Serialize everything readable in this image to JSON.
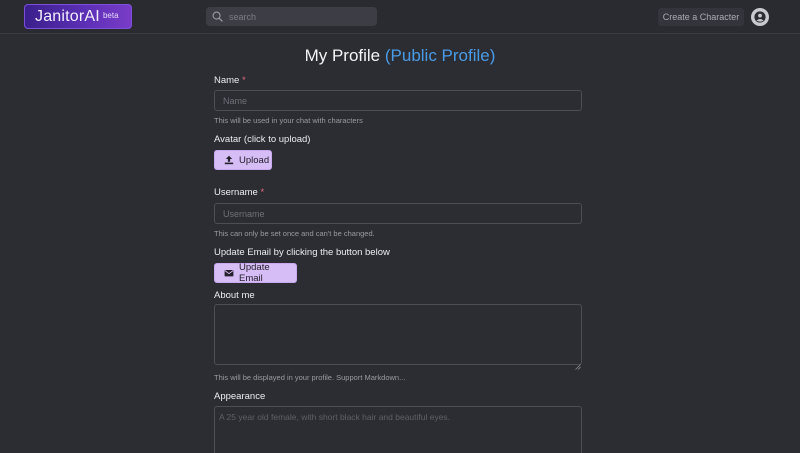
{
  "header": {
    "logo_text": "JanitorAI",
    "logo_badge": "beta",
    "search_placeholder": "search",
    "create_character_label": "Create a Character",
    "search_icon": "search-icon",
    "avatar_icon": "user-circle-icon"
  },
  "page": {
    "title": "My Profile",
    "public_profile_link": "(Public Profile)"
  },
  "form": {
    "name": {
      "label": "Name",
      "required_mark": "*",
      "placeholder": "Name",
      "help": "This will be used in your chat with characters"
    },
    "avatar": {
      "label": "Avatar (click to upload)",
      "upload_label": "Upload",
      "icon": "upload-icon"
    },
    "username": {
      "label": "Username",
      "required_mark": "*",
      "placeholder": "Username",
      "help": "This can only be set once and can't be changed."
    },
    "email": {
      "label": "Update Email by clicking the button below",
      "button_label": "Update Email",
      "icon": "envelope-icon"
    },
    "about": {
      "label": "About me",
      "help": "This will be displayed in your profile. Support Markdown..."
    },
    "appearance": {
      "label": "Appearance",
      "placeholder": "A 25 year old female, with short black hair and beautiful eyes."
    }
  },
  "colors": {
    "background": "#2c2d33",
    "accent_button": "#d6bdf5",
    "link_blue": "#4a9be6",
    "required_red": "#e26a7e",
    "logo_purple": "#5b2fb5"
  }
}
